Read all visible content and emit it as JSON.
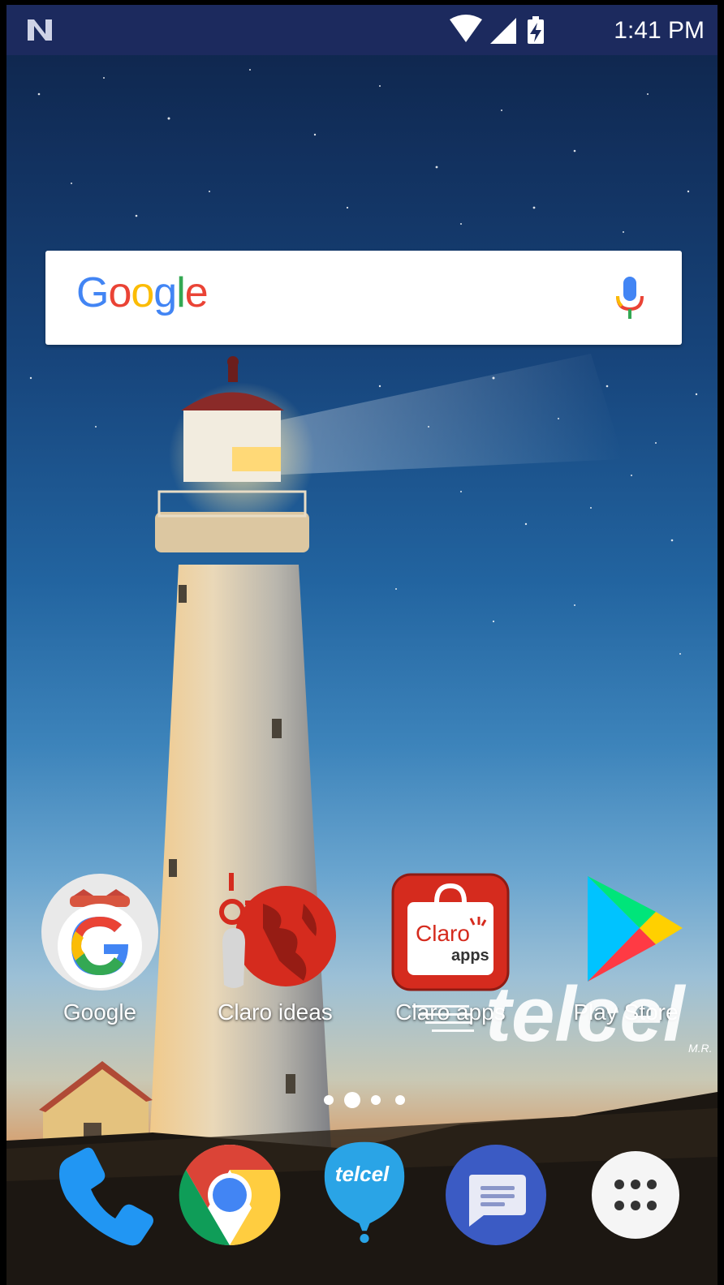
{
  "status_bar": {
    "notification_icon": "n-notification-icon",
    "wifi_icon": "wifi-icon",
    "signal_icon": "cell-signal-icon",
    "battery_icon": "battery-charging-icon",
    "time": "1:41 PM"
  },
  "search_widget": {
    "logo_letters": [
      {
        "ch": "G",
        "color": "#4285F4"
      },
      {
        "ch": "o",
        "color": "#EA4335"
      },
      {
        "ch": "o",
        "color": "#FBBC05"
      },
      {
        "ch": "g",
        "color": "#4285F4"
      },
      {
        "ch": "l",
        "color": "#34A853"
      },
      {
        "ch": "e",
        "color": "#EA4335"
      }
    ],
    "mic_icon": "microphone-icon"
  },
  "apps": [
    {
      "label": "Google",
      "icon": "google-app-icon"
    },
    {
      "label": "Claro ideas",
      "icon": "claro-ideas-icon"
    },
    {
      "label": "Claro apps",
      "icon": "claro-apps-icon",
      "icon_text_1": "Claro",
      "icon_text_2": "apps"
    },
    {
      "label": "Play Store",
      "icon": "play-store-icon"
    }
  ],
  "watermark": {
    "text": "telcel",
    "mark": "M.R."
  },
  "page_indicator": {
    "pages": 4,
    "current": 2
  },
  "dock": [
    {
      "icon": "phone-icon"
    },
    {
      "icon": "chrome-icon"
    },
    {
      "icon": "telcel-icon",
      "text": "telcel"
    },
    {
      "icon": "messages-icon"
    },
    {
      "icon": "app-drawer-icon"
    }
  ],
  "colors": {
    "status_bar": "#1c2a5e",
    "claro_red": "#d52b1e",
    "phone_blue": "#2196F3",
    "messages_blue": "#3b5bc4"
  }
}
